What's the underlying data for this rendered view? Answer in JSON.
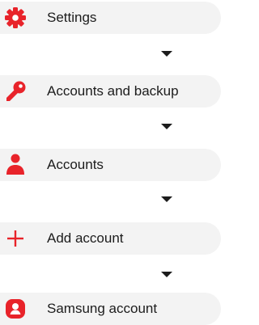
{
  "steps": [
    {
      "label": "Settings",
      "icon": "gear-icon"
    },
    {
      "label": "Accounts and backup",
      "icon": "key-icon"
    },
    {
      "label": "Accounts",
      "icon": "person-icon"
    },
    {
      "label": "Add account",
      "icon": "plus-icon"
    },
    {
      "label": "Samsung account",
      "icon": "samsung-account-icon"
    }
  ],
  "colors": {
    "accent": "#e8232a",
    "row_background": "#f3f3f3",
    "text": "#1c1c1c"
  }
}
